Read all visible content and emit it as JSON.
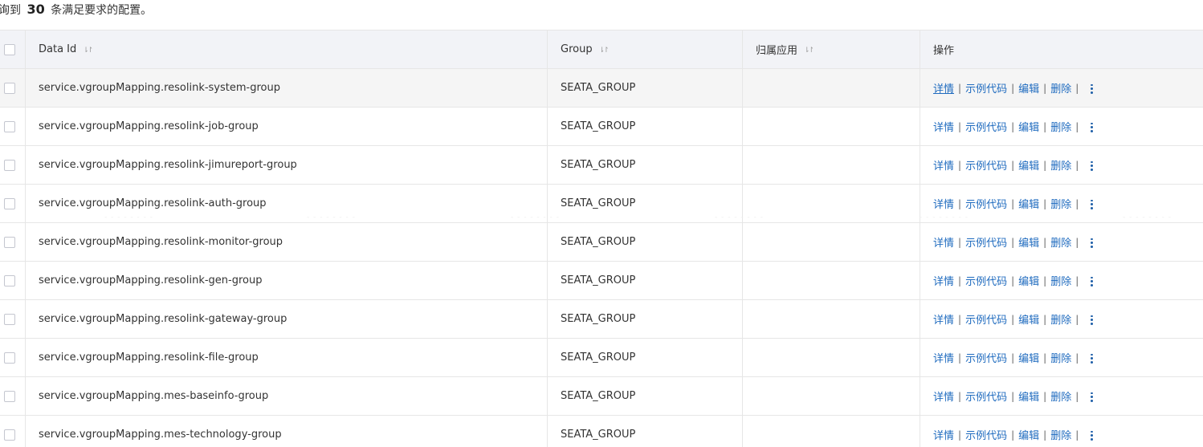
{
  "summary": {
    "prefix": "询到",
    "count": "30",
    "suffix": "条满足要求的配置。"
  },
  "table": {
    "columns": {
      "data_id": "Data Id",
      "group": "Group",
      "app": "归属应用",
      "ops": "操作"
    },
    "ops_labels": {
      "detail": "详情",
      "sample_code": "示例代码",
      "edit": "编辑",
      "delete": "删除",
      "separator": "|"
    },
    "rows": [
      {
        "data_id": "service.vgroupMapping.resolink-system-group",
        "group": "SEATA_GROUP",
        "app": ""
      },
      {
        "data_id": "service.vgroupMapping.resolink-job-group",
        "group": "SEATA_GROUP",
        "app": ""
      },
      {
        "data_id": "service.vgroupMapping.resolink-jimureport-group",
        "group": "SEATA_GROUP",
        "app": ""
      },
      {
        "data_id": "service.vgroupMapping.resolink-auth-group",
        "group": "SEATA_GROUP",
        "app": ""
      },
      {
        "data_id": "service.vgroupMapping.resolink-monitor-group",
        "group": "SEATA_GROUP",
        "app": ""
      },
      {
        "data_id": "service.vgroupMapping.resolink-gen-group",
        "group": "SEATA_GROUP",
        "app": ""
      },
      {
        "data_id": "service.vgroupMapping.resolink-gateway-group",
        "group": "SEATA_GROUP",
        "app": ""
      },
      {
        "data_id": "service.vgroupMapping.resolink-file-group",
        "group": "SEATA_GROUP",
        "app": ""
      },
      {
        "data_id": "service.vgroupMapping.mes-baseinfo-group",
        "group": "SEATA_GROUP",
        "app": ""
      },
      {
        "data_id": "service.vgroupMapping.mes-technology-group",
        "group": "SEATA_GROUP",
        "app": ""
      }
    ]
  },
  "icons": {
    "sort": "sort-icon",
    "more": "more-vertical-icon",
    "checkbox": "checkbox"
  },
  "colors": {
    "link": "#1f6bbf",
    "header_bg": "#f2f3f7",
    "border": "#e6e6e6",
    "hover_row_bg": "#f5f5f5"
  }
}
